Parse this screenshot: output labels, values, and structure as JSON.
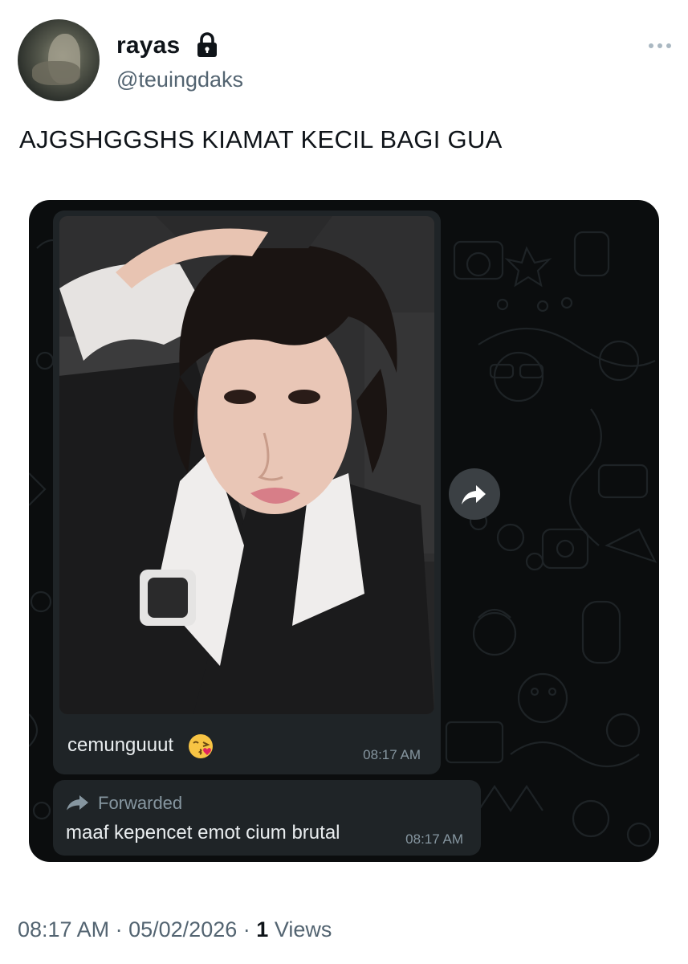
{
  "author": {
    "display_name": "rayas",
    "handle": "@teuingdaks",
    "protected_icon": "lock-icon"
  },
  "tweet": {
    "text": "AJGSHGGSHS KIAMAT KECIL BAGI GUA"
  },
  "chat_screenshot": {
    "message1": {
      "caption": "cemunguuut",
      "emoji": "face-blowing-kiss",
      "time": "08:17 AM"
    },
    "message2": {
      "forwarded_label": "Forwarded",
      "text": "maaf kepencet emot cium brutal",
      "time": "08:17 AM"
    },
    "forward_icon": "share-arrow-icon"
  },
  "footer": {
    "time": "08:17 AM",
    "separator": "·",
    "date": "05/02/2026",
    "views_count": "1",
    "views_label": "Views"
  },
  "colors": {
    "chat_background": "#0b0d0e",
    "bubble": "#1f2427",
    "bubble_text": "#e9edef",
    "meta_text": "#8696a0",
    "handle_gray": "#536471"
  }
}
